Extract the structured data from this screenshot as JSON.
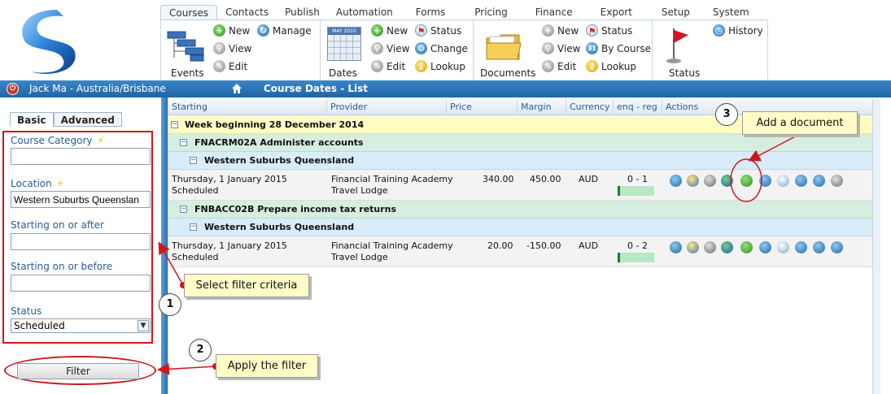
{
  "menu": {
    "tabs": [
      "Courses",
      "Contacts",
      "Publish",
      "Automation",
      "Forms",
      "Pricing",
      "Finance",
      "Export",
      "Setup",
      "System"
    ],
    "active": "Courses"
  },
  "ribbon": {
    "events": {
      "label": "Events",
      "new": "New",
      "manage": "Manage",
      "view": "View",
      "edit": "Edit"
    },
    "dates": {
      "label": "Dates",
      "calendar_text": "MAY 2010",
      "new": "New",
      "status": "Status",
      "view": "View",
      "change": "Change",
      "edit": "Edit",
      "lookup": "Lookup"
    },
    "documents": {
      "label": "Documents",
      "new": "New",
      "status": "Status",
      "view": "View",
      "by_course": "By Course",
      "edit": "Edit",
      "lookup": "Lookup",
      "by_course_icon_text": "31"
    },
    "status": {
      "label": "Status",
      "history": "History"
    }
  },
  "topbar": {
    "user": "Jack Ma - Australia/Brisbane",
    "page_title": "Course Dates - List"
  },
  "sidebar": {
    "tabs": [
      "Basic",
      "Advanced"
    ],
    "active_tab": "Basic",
    "fields": {
      "course_category": {
        "label": "Course Category",
        "value": ""
      },
      "location": {
        "label": "Location",
        "value": "Western Suburbs Queenslan"
      },
      "starting_after": {
        "label": "Starting on or after",
        "value": ""
      },
      "starting_before": {
        "label": "Starting on or before",
        "value": ""
      },
      "status": {
        "label": "Status",
        "value": "Scheduled"
      }
    },
    "filter_button": "Filter"
  },
  "grid": {
    "columns": [
      "Starting",
      "Provider",
      "Price",
      "Margin",
      "Currency",
      "enq - reg",
      "Actions"
    ],
    "week_group": "Week beginning 28 December 2014",
    "courses": [
      {
        "title": "FNACRM02A Administer accounts",
        "location": "Western Suburbs Queensland",
        "row": {
          "date": "Thursday, 1 January 2015",
          "status": "Scheduled",
          "provider": "Financial Training Academy",
          "venue": "Travel Lodge",
          "price": "340.00",
          "margin": "450.00",
          "currency": "AUD",
          "enq_reg": "0 - 1"
        }
      },
      {
        "title": "FNBACC02B Prepare income tax returns",
        "location": "Western Suburbs Queensland",
        "row": {
          "date": "Thursday, 1 January 2015",
          "status": "Scheduled",
          "provider": "Financial Training Academy",
          "venue": "Travel Lodge",
          "price": "20.00",
          "margin": "-150.00",
          "currency": "AUD",
          "enq_reg": "0 - 2"
        }
      }
    ],
    "action_icons": [
      "search-icon",
      "edit-icon",
      "copy-icon",
      "globe-icon",
      "add-document-icon",
      "refresh-icon",
      "flag-icon",
      "list-icon",
      "document-icon",
      "chart-icon"
    ]
  },
  "annotations": {
    "callout_1": "Select filter criteria",
    "callout_2": "Apply the filter",
    "callout_3": "Add a document",
    "num_1": "1",
    "num_2": "2",
    "num_3": "3"
  },
  "colors": {
    "accent": "#1f65a6",
    "highlight_red": "#d0161b",
    "week_row": "#fefcc2",
    "course_row": "#d6eee0",
    "location_row": "#d9ecf9"
  }
}
